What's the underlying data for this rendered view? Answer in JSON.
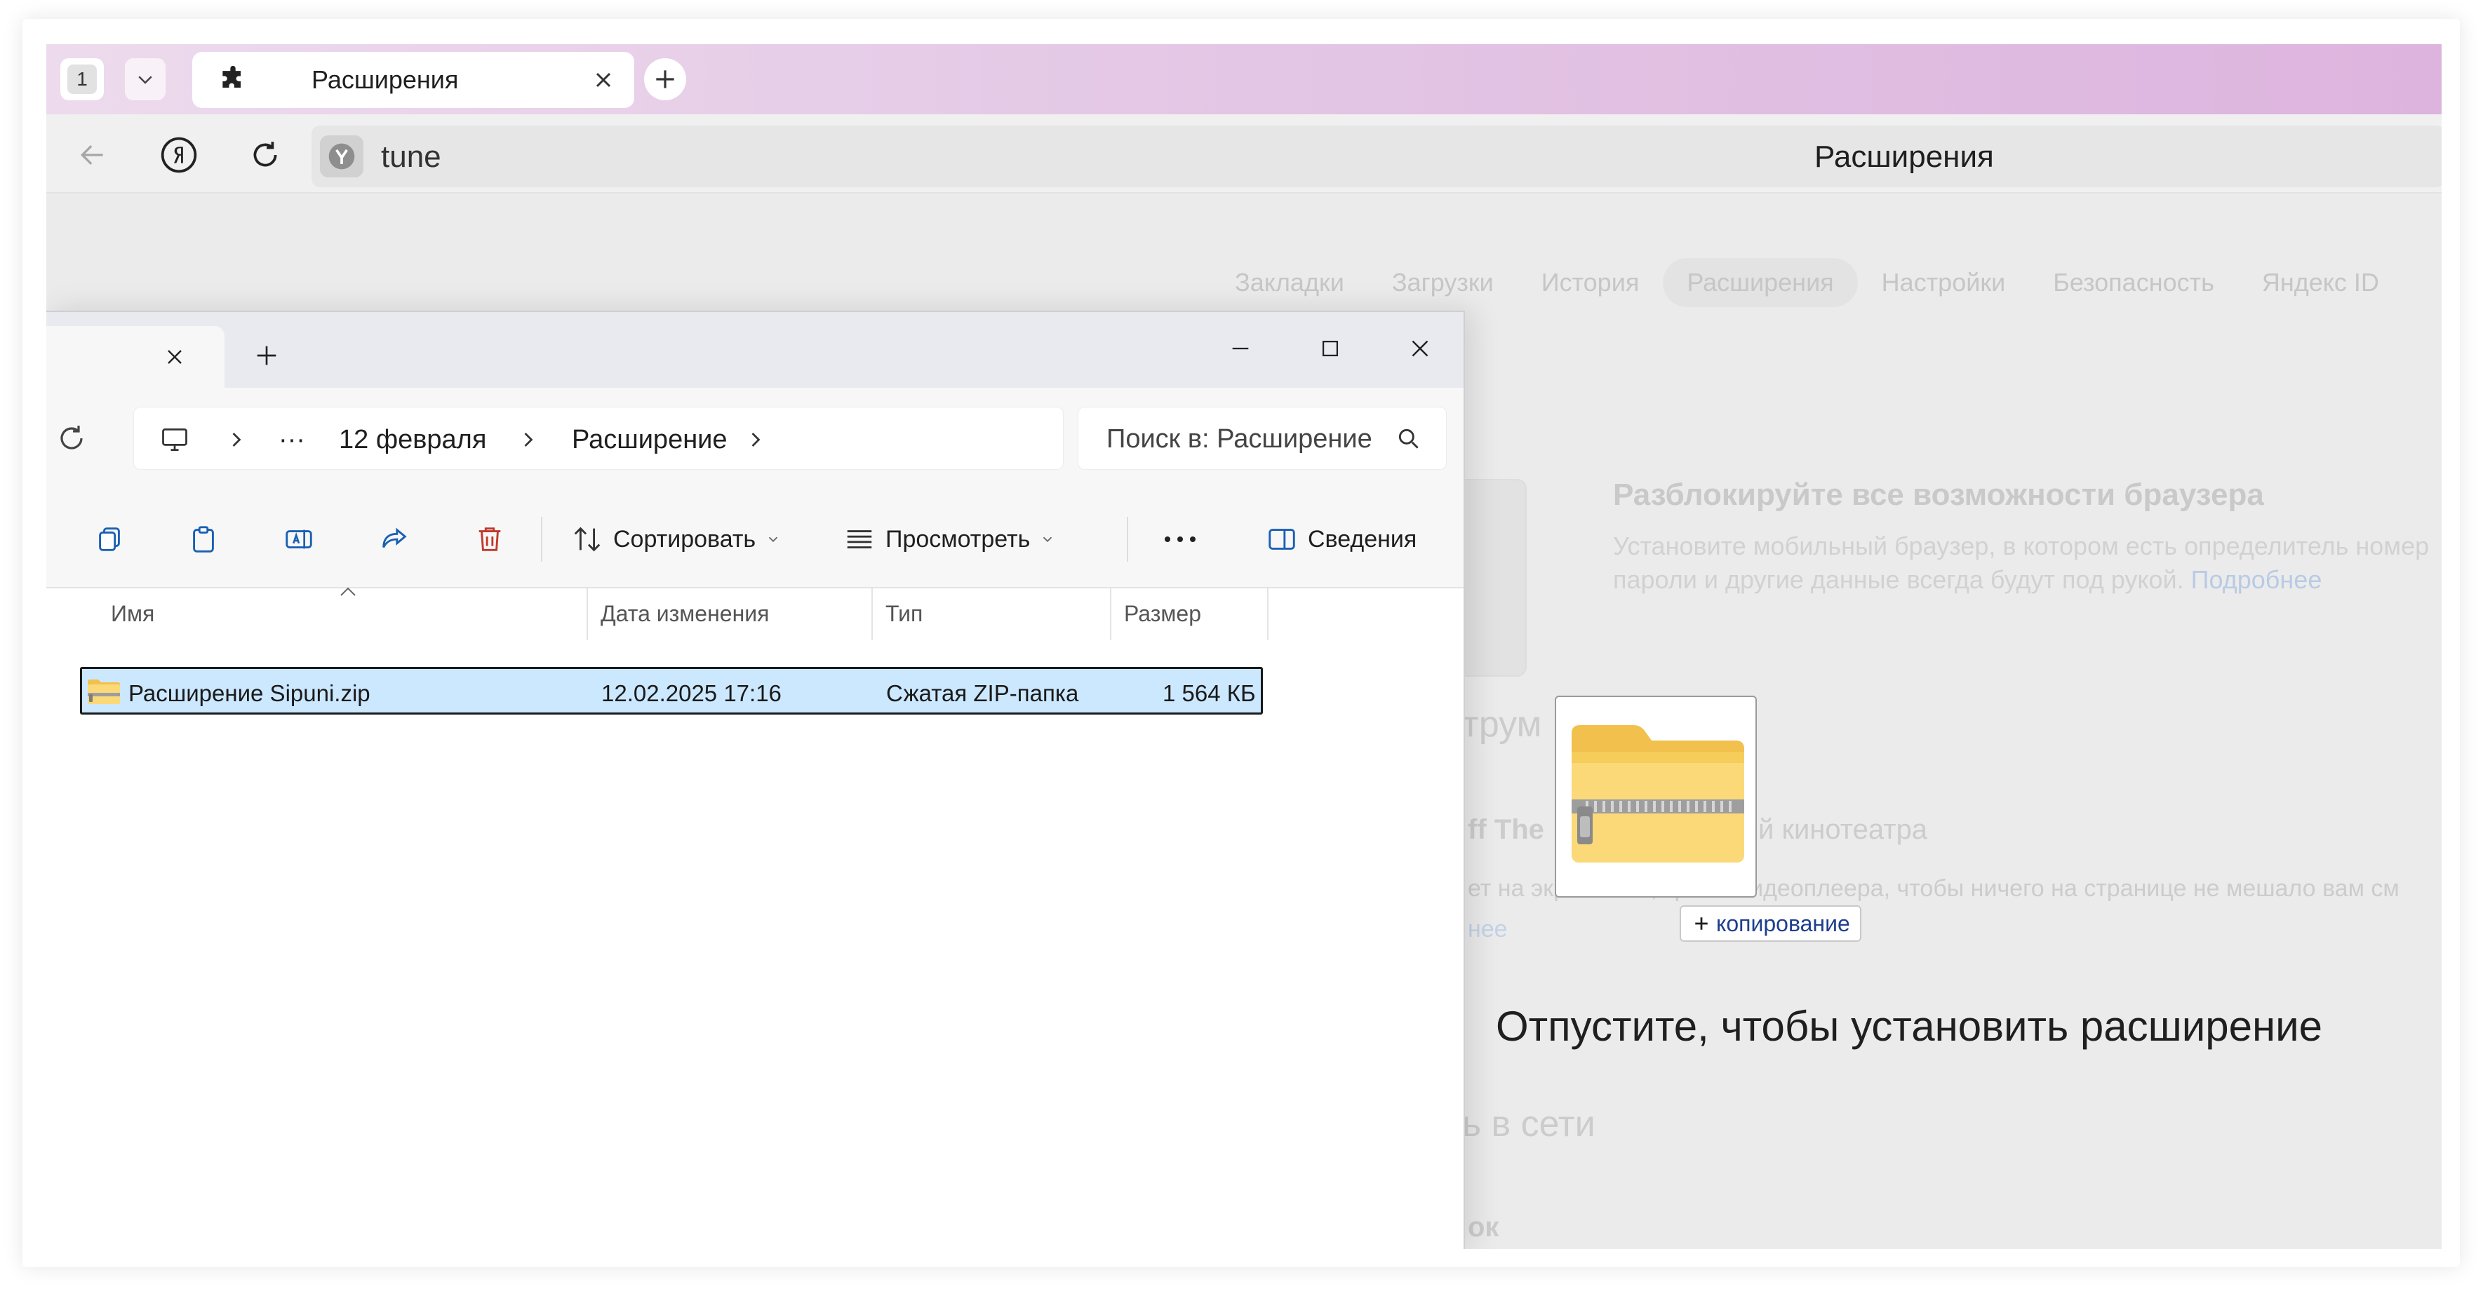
{
  "browser": {
    "tab_count": "1",
    "active_tab_title": "Расширения",
    "address_text": "tune",
    "page_title": "Расширения"
  },
  "page": {
    "nav": [
      "Закладки",
      "Загрузки",
      "История",
      "Расширения",
      "Настройки",
      "Безопасность",
      "Яндекс ID"
    ],
    "nav_active_index": 3,
    "promo": {
      "title": "Разблокируйте все возможности браузера",
      "text_line1": "Установите мобильный браузер, в котором есть определитель номер",
      "text_line2": "пароли и другие данные всегда будут под рукой.",
      "link": "Подробнее"
    },
    "ghost_texts": {
      "section1_fragment": "трум",
      "item_title_fragment": "ff The",
      "item_title_tail": "й кинотеатра",
      "item_desc": "ет на экране всё, кроме видеоплеера, чтобы ничего на странице не мешало вам см",
      "item_link_fragment": "нее",
      "section2_fragment": "ь в сети",
      "section3_fragment": "ок"
    },
    "drop_hint": "Отпустите, чтобы установить расширение",
    "drag_badge": "копирование"
  },
  "explorer": {
    "breadcrumb": [
      "12 февраля",
      "Расширение"
    ],
    "more_label": "···",
    "search_placeholder": "Поиск в: Расширение",
    "commands": {
      "sort": "Сортировать",
      "view": "Просмотреть",
      "details": "Сведения"
    },
    "columns": [
      "Имя",
      "Дата изменения",
      "Тип",
      "Размер"
    ],
    "files": [
      {
        "name": "Расширение Sipuni.zip",
        "modified": "12.02.2025 17:16",
        "type": "Сжатая ZIP-папка",
        "size": "1 564 КБ",
        "selected": true
      }
    ]
  },
  "colors": {
    "tabstrip_start": "#eddbed",
    "tabstrip_end": "#ddb4de",
    "selection": "#cce8ff",
    "folder_yellow": "#f6cd5a"
  }
}
